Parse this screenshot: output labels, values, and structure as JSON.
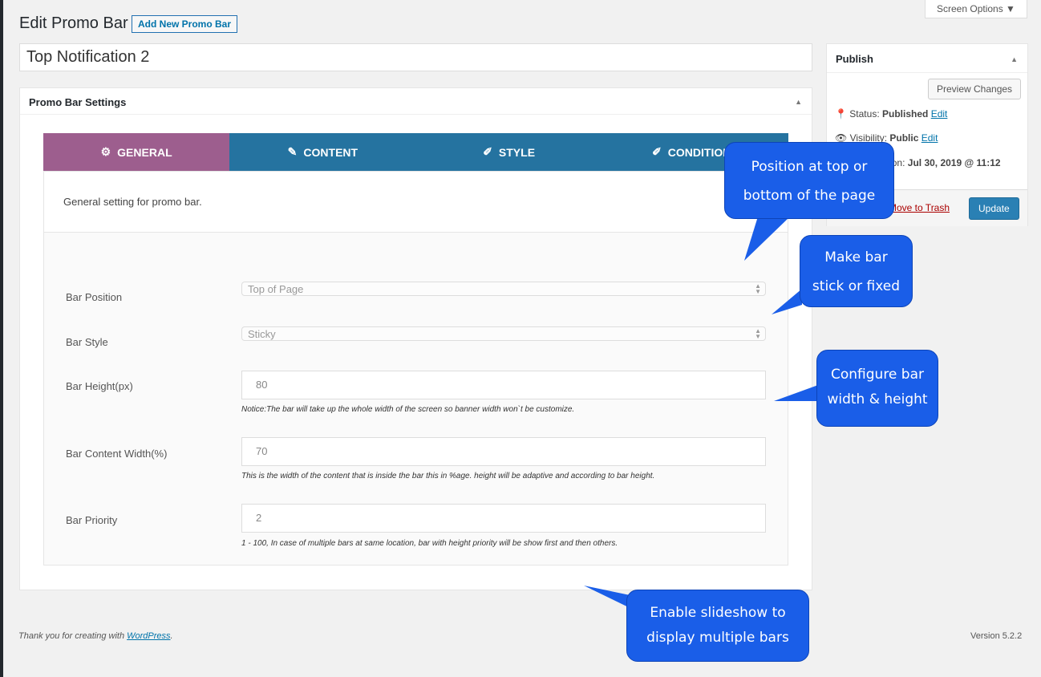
{
  "screen_options": "Screen Options ▼",
  "page_title": "Edit Promo Bar",
  "add_new": "Add New Promo Bar",
  "post_title": "Top Notification 2",
  "settings_box": {
    "title": "Promo Bar Settings",
    "tabs": [
      {
        "label": "GENERAL",
        "icon": "gear-icon"
      },
      {
        "label": "CONTENT",
        "icon": "pencil-icon"
      },
      {
        "label": "STYLE",
        "icon": "pin-icon"
      },
      {
        "label": "CONDITIONS",
        "icon": "pin-icon"
      }
    ],
    "description": "General setting for promo bar.",
    "fields": [
      {
        "label": "Bar Position",
        "value": "Top of Page"
      },
      {
        "label": "Bar Style",
        "value": "Sticky"
      },
      {
        "label": "Bar Height(px)",
        "value": "80",
        "note": "Notice:The bar will take up the whole width of the screen so banner width won`t be customize."
      },
      {
        "label": "Bar Content Width(%)",
        "value": "70",
        "note": "This is the width of the content that is inside the bar this in %age. height will be adaptive and according to bar height."
      },
      {
        "label": "Bar Priority",
        "value": "2",
        "note": "1 - 100, In case of multiple bars at same location, bar with height priority will be show first and then others."
      }
    ]
  },
  "publish": {
    "title": "Publish",
    "preview": "Preview Changes",
    "status_label": "Status:",
    "status": "Published",
    "visibility_label": "Visibility:",
    "visibility": "Public",
    "edit": "Edit",
    "published_label": "Published on:",
    "published": "Jul 30, 2019 @ 11:12",
    "trash": "Move to Trash",
    "update": "Update"
  },
  "footer": {
    "thanks": "Thank you for creating with ",
    "wp": "WordPress",
    "period": ".",
    "version": "Version 5.2.2"
  },
  "callouts": [
    "Position at top or bottom of the page",
    "Make bar stick or fixed",
    "Configure bar width & height",
    "Enable slideshow to display multiple bars"
  ],
  "colors": {
    "tab_active": "#9d5e8e",
    "tab": "#2573a0",
    "callout": "#1a5ee8"
  }
}
